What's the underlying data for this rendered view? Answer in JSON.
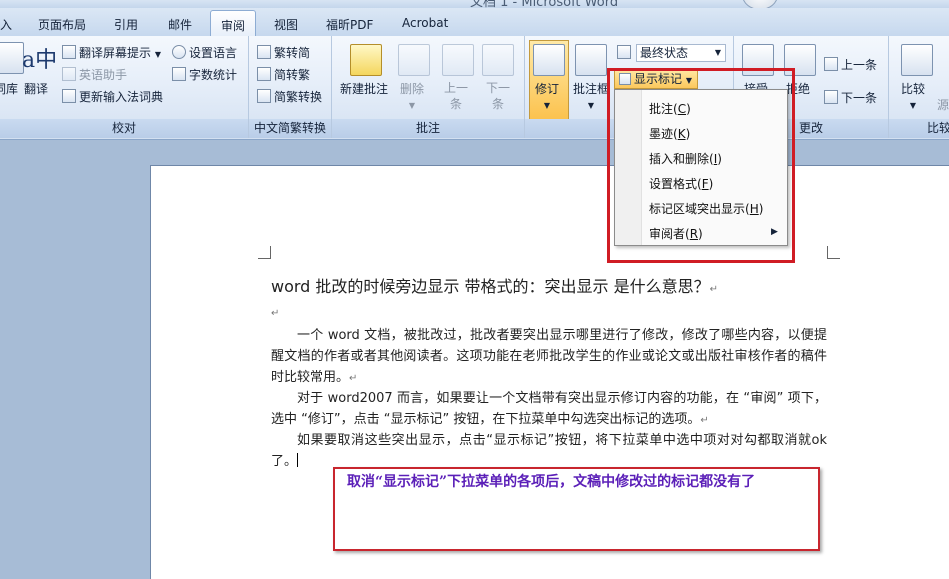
{
  "title_bar": {
    "text": "文档 1 - Microsoft Word"
  },
  "tabs": [
    {
      "label": "入"
    },
    {
      "label": "页面布局"
    },
    {
      "label": "引用"
    },
    {
      "label": "邮件"
    },
    {
      "label": "审阅",
      "active": true
    },
    {
      "label": "视图"
    },
    {
      "label": "福昕PDF"
    },
    {
      "label": "Acrobat"
    }
  ],
  "ribbon": {
    "proofing": {
      "label": "校对",
      "lib_button": "词库",
      "translate_button": "翻译",
      "translate_tip": "翻译屏幕提示",
      "english_assistant": "英语助手",
      "update_ime": "更新输入法词典",
      "set_language": "设置语言",
      "word_count": "字数统计"
    },
    "chinese_conversion": {
      "label": "中文简繁转换",
      "to_simplified": "繁转简",
      "to_traditional": "简转繁",
      "convert": "简繁转换"
    },
    "comments": {
      "label": "批注",
      "new": "新建批注",
      "delete": "删除",
      "prev": "上一条",
      "next": "下一条"
    },
    "tracking": {
      "label": "修订",
      "track": "修订",
      "balloon": "批注框",
      "display_mode": "最终状态",
      "show_markup": "显示标记"
    },
    "changes": {
      "label": "更改",
      "accept": "接受",
      "reject": "拒绝",
      "prev": "上一条",
      "next": "下一条"
    },
    "compare": {
      "label": "比较",
      "compare": "比较",
      "source": "源"
    }
  },
  "menu": {
    "items": [
      {
        "label": "批注(",
        "key": "C"
      },
      {
        "label": "墨迹(",
        "key": "K"
      },
      {
        "label": "插入和删除(",
        "key": "I"
      },
      {
        "label": "设置格式(",
        "key": "F"
      },
      {
        "label": "标记区域突出显示(",
        "key": "H"
      },
      {
        "label": "审阅者(",
        "key": "R"
      }
    ]
  },
  "document": {
    "title": "word 批改的时候旁边显示 带格式的：突出显示 是什么意思？",
    "para1": "一个 word 文档，被批改过，批改者要突出显示哪里进行了修改，修改了哪些内容，以便提醒文档的作者或者其他阅读者。这项功能在老师批改学生的作业或论文或出版社审核作者的稿件时比较常用。",
    "para2": "对于 word2007 而言，如果要让一个文档带有突出显示修订内容的功能，在 “审阅” 项下，选中 “修订”，点击 “显示标记” 按钮，在下拉菜单中勾选突出标记的选项。",
    "para3": "如果要取消这些突出显示，点击“显示标记”按钮，将下拉菜单中选中项对对勾都取消就ok 了。"
  },
  "callout": {
    "text": "取消“显示标记”下拉菜单的各项后，文稿中修改过的标记都没有了"
  }
}
